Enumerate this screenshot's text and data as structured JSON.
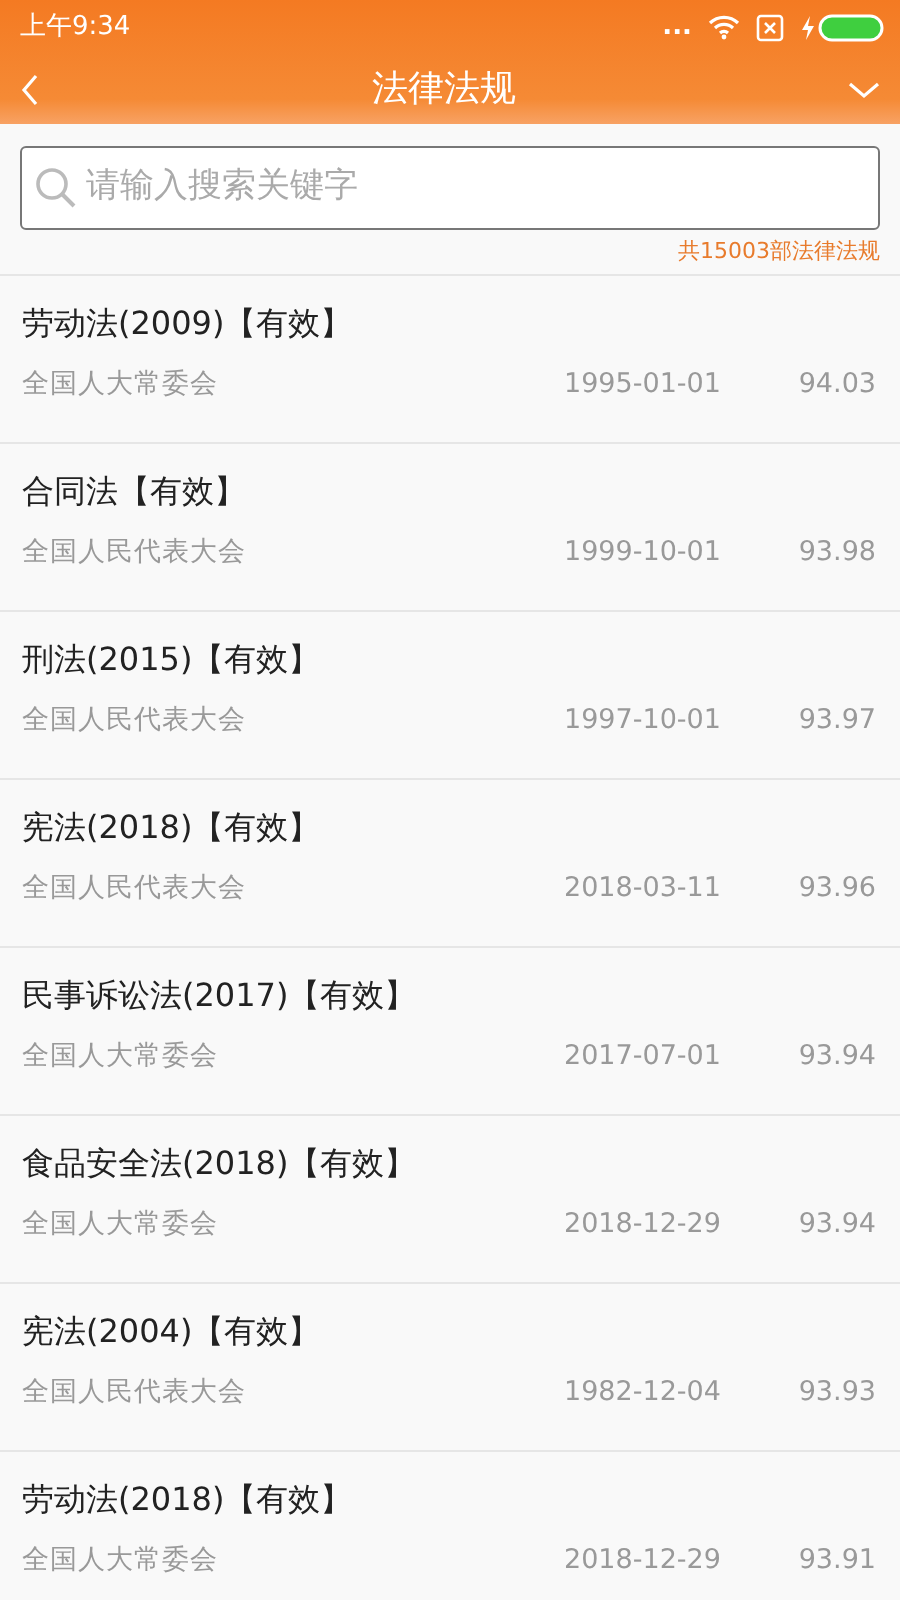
{
  "status_bar": {
    "time": "上午9:34",
    "dots": "..."
  },
  "header": {
    "title": "法律法规"
  },
  "search": {
    "placeholder": "请输入搜索关键字"
  },
  "count": "共15003部法律法规",
  "laws": [
    {
      "title": "劳动法(2009)【有效】",
      "issuer": "全国人大常委会",
      "date": "1995-01-01",
      "score": "94.03"
    },
    {
      "title": "合同法【有效】",
      "issuer": "全国人民代表大会",
      "date": "1999-10-01",
      "score": "93.98"
    },
    {
      "title": "刑法(2015)【有效】",
      "issuer": "全国人民代表大会",
      "date": "1997-10-01",
      "score": "93.97"
    },
    {
      "title": "宪法(2018)【有效】",
      "issuer": "全国人民代表大会",
      "date": "2018-03-11",
      "score": "93.96"
    },
    {
      "title": "民事诉讼法(2017)【有效】",
      "issuer": "全国人大常委会",
      "date": "2017-07-01",
      "score": "93.94"
    },
    {
      "title": "食品安全法(2018)【有效】",
      "issuer": "全国人大常委会",
      "date": "2018-12-29",
      "score": "93.94"
    },
    {
      "title": "宪法(2004)【有效】",
      "issuer": "全国人民代表大会",
      "date": "1982-12-04",
      "score": "93.93"
    },
    {
      "title": "劳动法(2018)【有效】",
      "issuer": "全国人大常委会",
      "date": "2018-12-29",
      "score": "93.91"
    }
  ]
}
